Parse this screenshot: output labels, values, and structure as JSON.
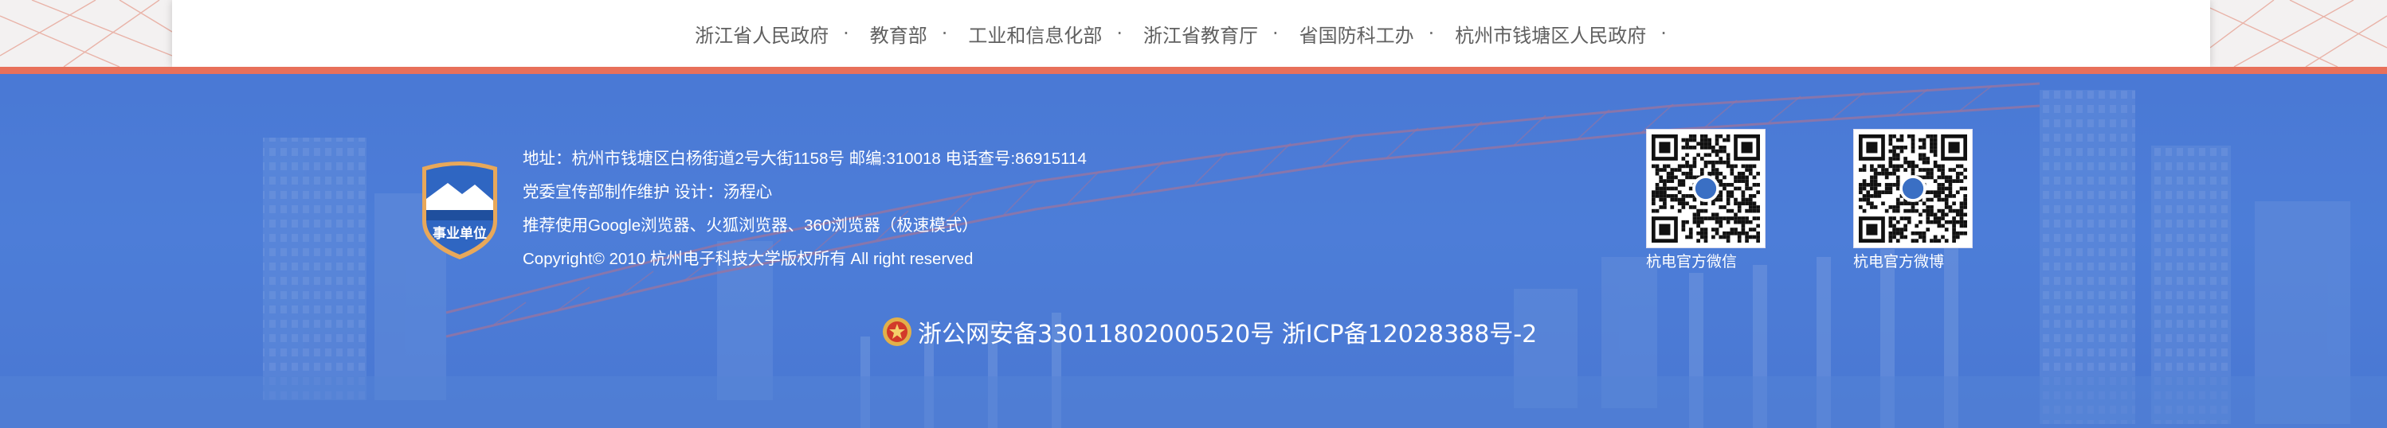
{
  "links": [
    {
      "label": "浙江省人民政府",
      "sep": "·"
    },
    {
      "label": "教育部",
      "sep": "·"
    },
    {
      "label": "工业和信息化部",
      "sep": "·"
    },
    {
      "label": "浙江省教育厅",
      "sep": "·"
    },
    {
      "label": "省国防科工办",
      "sep": "·"
    },
    {
      "label": "杭州市钱塘区人民政府",
      "sep": "·"
    }
  ],
  "footer": {
    "emblem_text": "事业单位",
    "address": "地址：杭州市钱塘区白杨街道2号大街1158号 邮编:310018 电话查号:86915114",
    "maintainer": "党委宣传部制作维护 设计：汤程心",
    "browsers": "推荐使用Google浏览器、火狐浏览器、360浏览器（极速模式）",
    "copyright": "Copyright© 2010 杭州电子科技大学版权所有 All right reserved",
    "icp": "浙公网安备33011802000520号 浙ICP备12028388号-2",
    "qr_wechat_label": "杭电官方微信",
    "qr_weibo_label": "杭电官方微博"
  },
  "colors": {
    "accent": "#e8705a",
    "footer_bg": "#4f7fd9",
    "link_text": "#606060"
  }
}
